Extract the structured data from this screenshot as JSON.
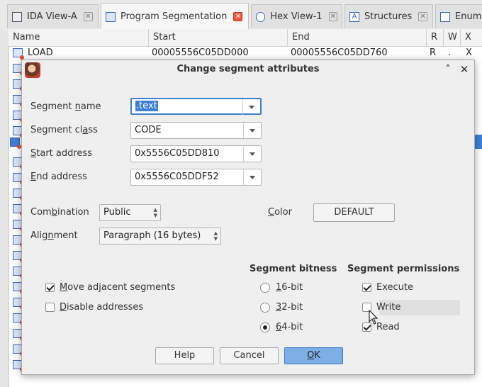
{
  "tabs": [
    {
      "label": "IDA View-A",
      "icon": "ida-view-icon"
    },
    {
      "label": "Program Segmentation",
      "icon": "segmentation-icon"
    },
    {
      "label": "Hex View-1",
      "icon": "hex-view-icon"
    },
    {
      "label": "Structures",
      "icon": "structures-icon"
    },
    {
      "label": "Enum",
      "icon": "enums-icon"
    }
  ],
  "table": {
    "columns": [
      "Name",
      "Start",
      "End",
      "R",
      "W",
      "X"
    ],
    "rows": [
      {
        "name": "LOAD",
        "start": "00005556C05DD000",
        "end": "00005556C05DD760",
        "r": "R",
        "w": ".",
        "x": "X"
      }
    ]
  },
  "dialog": {
    "title": "Change segment attributes",
    "segment_name": {
      "label_pre": "Segment ",
      "label_u": "n",
      "label_post": "ame",
      "value": ".text"
    },
    "segment_class": {
      "label_pre": "Segment cl",
      "label_u": "a",
      "label_post": "ss",
      "value": "CODE"
    },
    "start_address": {
      "label_pre": "",
      "label_u": "S",
      "label_post": "tart address",
      "value": "0x5556C05DD810"
    },
    "end_address": {
      "label_pre": "",
      "label_u": "E",
      "label_post": "nd address",
      "value": "0x5556C05DDF52"
    },
    "combination": {
      "label_pre": "Com",
      "label_u": "b",
      "label_post": "ination",
      "value": "Public"
    },
    "alignment": {
      "label_pre": "Alig",
      "label_u": "n",
      "label_post": "ment",
      "value": "Paragraph (16 bytes)"
    },
    "color": {
      "label_u": "C",
      "label_post": "olor",
      "button": "DEFAULT"
    },
    "move_adjacent": {
      "label_u": "M",
      "label_post": "ove adjacent segments",
      "checked": true
    },
    "disable_addresses": {
      "label_u": "D",
      "label_post": "isable addresses",
      "checked": false
    },
    "bitness": {
      "title": "Segment bitness",
      "options": [
        {
          "u": "1",
          "rest": "6-bit",
          "selected": false
        },
        {
          "u": "3",
          "rest": "2-bit",
          "selected": false
        },
        {
          "u": "6",
          "rest": "4-bit",
          "selected": true
        }
      ]
    },
    "permissions": {
      "title": "Segment permissions",
      "items": [
        {
          "label": "Execute",
          "checked": true
        },
        {
          "label": "Write",
          "checked": false
        },
        {
          "label": "Read",
          "checked": true
        }
      ]
    },
    "buttons": {
      "help": "Help",
      "cancel": "Cancel",
      "ok_u": "O",
      "ok_rest": "K"
    }
  }
}
